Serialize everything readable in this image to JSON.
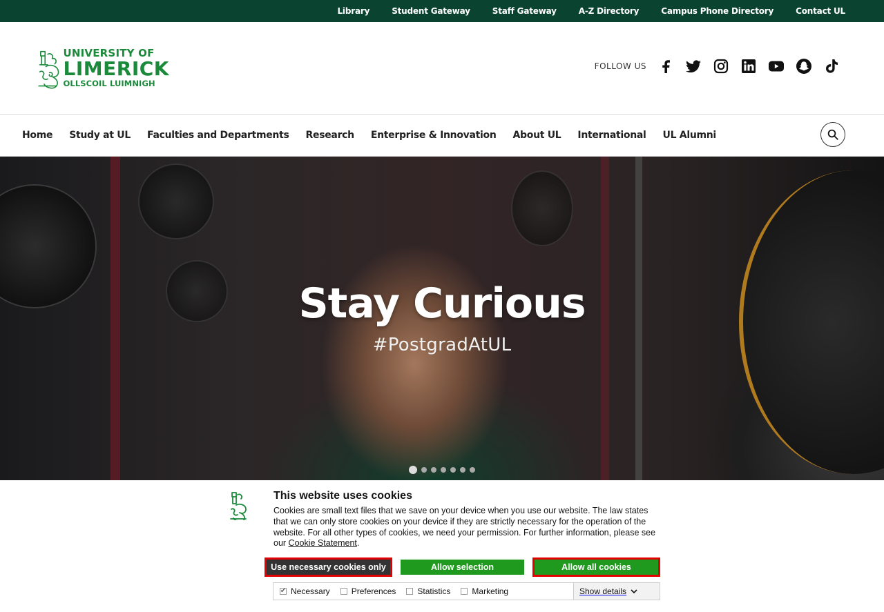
{
  "utility_nav": [
    "Library",
    "Student Gateway",
    "Staff Gateway",
    "A-Z Directory",
    "Campus Phone Directory",
    "Contact UL"
  ],
  "logo": {
    "line1": "UNIVERSITY OF",
    "line2": "LIMERICK",
    "line3": "OLLSCOIL LUIMNIGH"
  },
  "follow_us": "FOLLOW US",
  "social_icons": [
    "facebook-icon",
    "twitter-icon",
    "instagram-icon",
    "linkedin-icon",
    "youtube-icon",
    "snapchat-icon",
    "tiktok-icon"
  ],
  "main_nav": [
    "Home",
    "Study at UL",
    "Faculties and Departments",
    "Research",
    "Enterprise & Innovation",
    "About UL",
    "International",
    "UL Alumni"
  ],
  "hero": {
    "title": "Stay Curious",
    "subtitle": "#PostgradAtUL",
    "slide_count": 7,
    "active_slide": 1
  },
  "cookie": {
    "title": "This website uses cookies",
    "text": "Cookies are small text files that we save on your device when you use our website. The law states that we can only store cookies on your device if they are strictly necessary for the operation of the website. For all other types of cookies, we need your permission. For further information, please see our ",
    "link": "Cookie Statement",
    "text_end": ".",
    "buttons": {
      "necessary": "Use necessary cookies only",
      "selection": "Allow selection",
      "all": "Allow all cookies"
    },
    "levels": [
      {
        "label": "Necessary",
        "checked": true
      },
      {
        "label": "Preferences",
        "checked": false
      },
      {
        "label": "Statistics",
        "checked": false
      },
      {
        "label": "Marketing",
        "checked": false
      }
    ],
    "show_details": "Show details"
  },
  "colors": {
    "utility_bar": "#0a4430",
    "brand_green": "#1b8a3b",
    "button_green": "#1f9a1f",
    "highlight_red": "#e30000"
  }
}
